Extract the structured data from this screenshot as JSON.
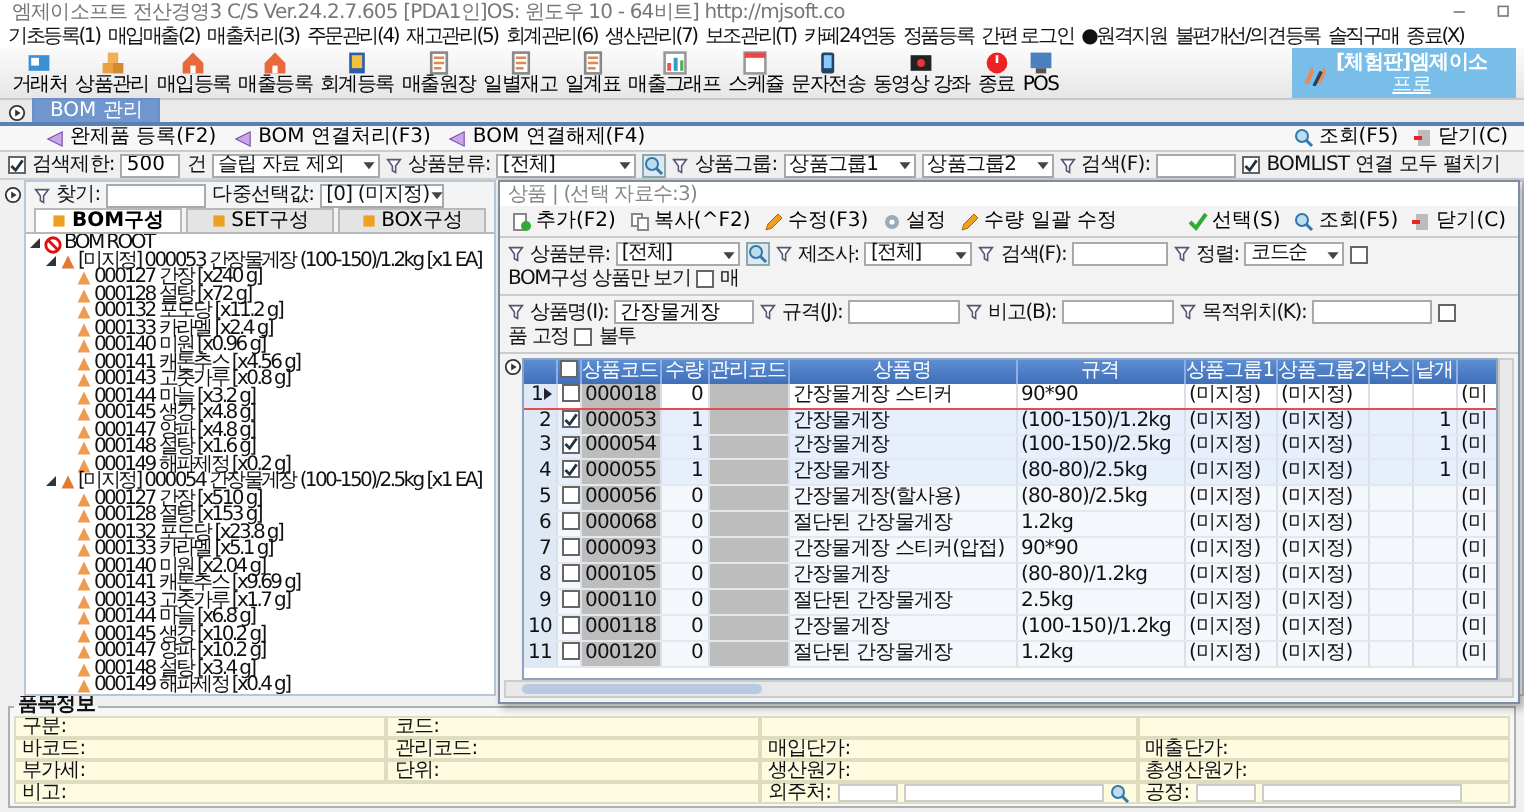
{
  "window": {
    "title": "엠제이소프트 전산경영3 C/S  Ver.24.2.7.605  [PDA1인]OS: 윈도우 10 - 64비트]  http://mjsoft.co"
  },
  "menu": [
    "기초등록(1)",
    "매입매출(2)",
    "매출처리(3)",
    "주문관리(4)",
    "재고관리(5)",
    "회계관리(6)",
    "생산관리(7)",
    "보조관리(T)",
    "카페24연동",
    "정품등록",
    "간편 로그인",
    "●원격지원",
    "불편개선/의견등록",
    "솔직구매",
    "종료(X)"
  ],
  "toolbar": [
    {
      "label": "거래처",
      "kind": "card"
    },
    {
      "label": "상품관리",
      "kind": "boxes"
    },
    {
      "label": "매입등록",
      "kind": "house"
    },
    {
      "label": "매출등록",
      "kind": "house"
    },
    {
      "label": "회계등록",
      "kind": "ledger"
    },
    {
      "label": "매출원장",
      "kind": "doc"
    },
    {
      "label": "일별재고",
      "kind": "doc"
    },
    {
      "label": "일계표",
      "kind": "doc"
    },
    {
      "label": "매출그래프",
      "kind": "chart"
    },
    {
      "label": "스케쥴",
      "kind": "calendar"
    },
    {
      "label": "문자전송",
      "kind": "phone"
    },
    {
      "label": "동영상 강좌",
      "kind": "video"
    },
    {
      "label": "종료",
      "kind": "power"
    },
    {
      "label": "POS",
      "kind": "monitor"
    }
  ],
  "trial_badge": {
    "title": "[체험판]엠제이소",
    "link": "프로"
  },
  "doc_tabs": [
    {
      "label": "BOM 관리",
      "selected": true
    }
  ],
  "actions": [
    "완제품 등록(F2)",
    "BOM 연결처리(F3)",
    "BOM 연결해제(F4)"
  ],
  "right_actions": [
    {
      "label": "조회(F5)",
      "kind": "search"
    },
    {
      "label": "닫기(C)",
      "kind": "close"
    }
  ],
  "filter": {
    "limit_checked": true,
    "limit_label": "검색제한:",
    "limit_value": "500",
    "limit_unit": "건",
    "slip_option": "슬립 자료 제외",
    "category_label": "상품분류:",
    "category_value": "[전체]",
    "group_label": "상품그룹:",
    "group1": "상품그룹1",
    "group2": "상품그룹2",
    "search_label": "검색(F):",
    "expand_checked": true,
    "expand_label": "BOMLIST 연결 모두 펼치기"
  },
  "left_panel": {
    "find_label": "찾기:",
    "multi_label": "다중선택값:",
    "multi_value": "[0] (미지정)",
    "tabs": [
      {
        "label": "BOM구성",
        "selected": true
      },
      {
        "label": "SET구성",
        "selected": false
      },
      {
        "label": "BOX구성",
        "selected": false
      }
    ],
    "tree": [
      {
        "label": "BOM ROOT",
        "kind": "root",
        "expanded": true,
        "children": [
          {
            "label": "[미지정] 000053 간장물게장 (100-150)/1.2kg [x1 EA]",
            "kind": "product",
            "expanded": true,
            "children": [
              {
                "label": "000127 간장 [x240 g]",
                "kind": "material"
              },
              {
                "label": "000128 설탕 [x72 g]",
                "kind": "material"
              },
              {
                "label": "000132 포도당 [x11.2 g]",
                "kind": "material"
              },
              {
                "label": "000133 카라멜 [x2.4 g]",
                "kind": "material"
              },
              {
                "label": "000140 미원 [x0.96 g]",
                "kind": "material"
              },
              {
                "label": "000141 캐톤추스 [x4.56 g]",
                "kind": "material"
              },
              {
                "label": "000143 고춧가루 [x0.8 g]",
                "kind": "material"
              },
              {
                "label": "000144 마늘 [x3.2 g]",
                "kind": "material"
              },
              {
                "label": "000145 생강 [x4.8 g]",
                "kind": "material"
              },
              {
                "label": "000147 양파 [x4.8 g]",
                "kind": "material"
              },
              {
                "label": "000148 설탕 [x1.6 g]",
                "kind": "material"
              },
              {
                "label": "000149 해파제정 [x0.2 g]",
                "kind": "material"
              }
            ]
          },
          {
            "label": "[미지정] 000054 간장물게장 (100-150)/2.5kg [x1 EA]",
            "kind": "product",
            "expanded": true,
            "children": [
              {
                "label": "000127 간장 [x510 g]",
                "kind": "material"
              },
              {
                "label": "000128 설탕 [x153 g]",
                "kind": "material"
              },
              {
                "label": "000132 포도당 [x23.8 g]",
                "kind": "material"
              },
              {
                "label": "000133 카라멜 [x5.1 g]",
                "kind": "material"
              },
              {
                "label": "000140 미원 [x2.04 g]",
                "kind": "material"
              },
              {
                "label": "000141 캐톤추스 [x9.69 g]",
                "kind": "material"
              },
              {
                "label": "000143 고춧가루 [x1.7 g]",
                "kind": "material"
              },
              {
                "label": "000144 마늘 [x6.8 g]",
                "kind": "material"
              },
              {
                "label": "000145 생강 [x10.2 g]",
                "kind": "material"
              },
              {
                "label": "000147 양파 [x10.2 g]",
                "kind": "material"
              },
              {
                "label": "000148 설탕 [x3.4 g]",
                "kind": "material"
              },
              {
                "label": "000149 해파제정 [x0.4 g]",
                "kind": "material"
              }
            ]
          }
        ]
      }
    ]
  },
  "dialog": {
    "title": "상품 | (선택 자료수:3)",
    "tools": [
      {
        "label": "추가(F2)",
        "kind": "add"
      },
      {
        "label": "복사(^F2)",
        "kind": "copy"
      },
      {
        "label": "수정(F3)",
        "kind": "edit"
      },
      {
        "label": "설정",
        "kind": "settings"
      },
      {
        "label": "수량 일괄 수정",
        "kind": "edit"
      }
    ],
    "right_tools": [
      {
        "label": "선택(S)",
        "kind": "check"
      },
      {
        "label": "조회(F5)",
        "kind": "search"
      },
      {
        "label": "닫기(C)",
        "kind": "close"
      }
    ],
    "select_all_checked": false,
    "category_label": "상품분류:",
    "category_value": "[전체]",
    "maker_label": "제조사:",
    "maker_value": "[전체]",
    "search_label": "검색(F):",
    "sort_label": "정렬:",
    "sort_value": "코드순",
    "checks_1": [
      {
        "label": "BOM구성 상품만 보기",
        "checked": false
      },
      {
        "label": "매",
        "checked": false
      }
    ],
    "name_label": "상품명(I):",
    "name_value": "간장물게장",
    "spec_label": "규격(J):",
    "memo_label": "비고(B):",
    "location_label": "목적위치(K):",
    "checks_2": [
      {
        "label": "품 고정",
        "checked": false
      },
      {
        "label": "불투",
        "checked": false
      }
    ],
    "columns": [
      "상품코드",
      "수량",
      "관리코드",
      "상품명",
      "규격",
      "상품그룹1",
      "상품그룹2",
      "박스",
      "낱개"
    ],
    "rows": [
      {
        "no": "1",
        "checked": false,
        "selected": true,
        "code": "000018",
        "qty": "0",
        "name": "간장물게장 스티커",
        "spec": "90*90",
        "group1": "(미지정)",
        "group2": "(미지정)",
        "extra": "(미"
      },
      {
        "no": "2",
        "checked": true,
        "selected": false,
        "code": "000053",
        "qty": "1",
        "name": "간장물게장",
        "spec": "(100-150)/1.2kg",
        "group1": "(미지정)",
        "group2": "(미지정)",
        "each": "1",
        "extra": "(미"
      },
      {
        "no": "3",
        "checked": true,
        "selected": false,
        "code": "000054",
        "qty": "1",
        "name": "간장물게장",
        "spec": "(100-150)/2.5kg",
        "group1": "(미지정)",
        "group2": "(미지정)",
        "each": "1",
        "extra": "(미"
      },
      {
        "no": "4",
        "checked": true,
        "selected": false,
        "code": "000055",
        "qty": "1",
        "name": "간장물게장",
        "spec": "(80-80)/2.5kg",
        "group1": "(미지정)",
        "group2": "(미지정)",
        "each": "1",
        "extra": "(미"
      },
      {
        "no": "5",
        "checked": false,
        "selected": false,
        "code": "000056",
        "qty": "0",
        "name": "간장물게장(할사용)",
        "spec": "(80-80)/2.5kg",
        "group1": "(미지정)",
        "group2": "(미지정)",
        "extra": "(미"
      },
      {
        "no": "6",
        "checked": false,
        "selected": false,
        "code": "000068",
        "qty": "0",
        "name": "절단된 간장물게장",
        "spec": "1.2kg",
        "group1": "(미지정)",
        "group2": "(미지정)",
        "extra": "(미"
      },
      {
        "no": "7",
        "checked": false,
        "selected": false,
        "code": "000093",
        "qty": "0",
        "name": "간장물게장 스티커(압접)",
        "spec": "90*90",
        "group1": "(미지정)",
        "group2": "(미지정)",
        "extra": "(미"
      },
      {
        "no": "8",
        "checked": false,
        "selected": false,
        "code": "000105",
        "qty": "0",
        "name": "간장물게장",
        "spec": "(80-80)/1.2kg",
        "group1": "(미지정)",
        "group2": "(미지정)",
        "extra": "(미"
      },
      {
        "no": "9",
        "checked": false,
        "selected": false,
        "code": "000110",
        "qty": "0",
        "name": "절단된 간장물게장",
        "spec": "2.5kg",
        "group1": "(미지정)",
        "group2": "(미지정)",
        "extra": "(미"
      },
      {
        "no": "10",
        "checked": false,
        "selected": false,
        "code": "000118",
        "qty": "0",
        "name": "간장물게장",
        "spec": "(100-150)/1.2kg",
        "group1": "(미지정)",
        "group2": "(미지정)",
        "extra": "(미"
      },
      {
        "no": "11",
        "checked": false,
        "selected": false,
        "code": "000120",
        "qty": "0",
        "name": "절단된 간장물게장",
        "spec": "1.2kg",
        "group1": "(미지정)",
        "group2": "(미지정)",
        "extra": "(미"
      }
    ]
  },
  "info_panel": {
    "title": "품목정보",
    "rows": [
      [
        "구분:",
        "코드:"
      ],
      [
        "바코드:",
        "관리코드:",
        "매입단가:",
        "매출단가:"
      ],
      [
        "부가세:",
        "단위:",
        "생산원가:",
        "총생산원가:"
      ]
    ],
    "memo_label": "비고:",
    "vendor_label": "외주처:",
    "process_label": "공정:"
  }
}
